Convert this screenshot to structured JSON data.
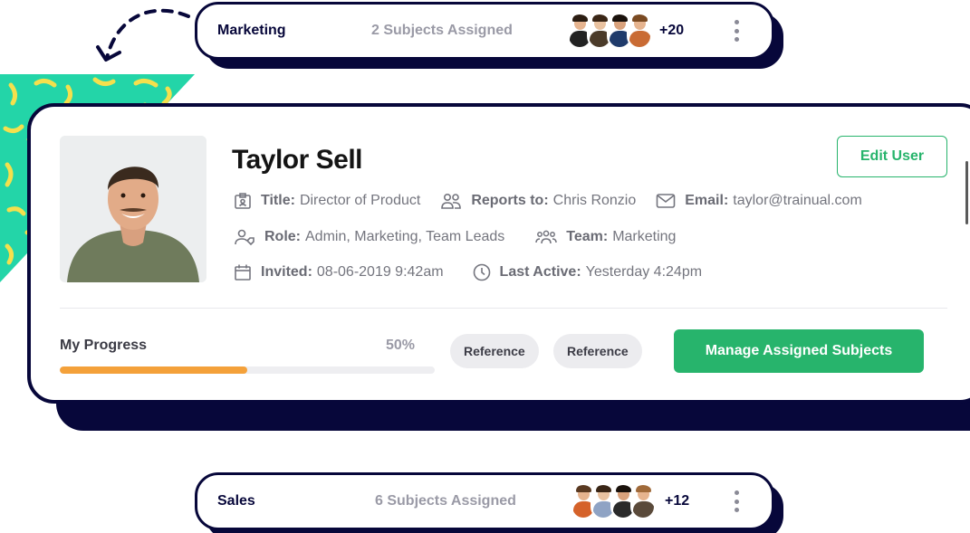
{
  "groups": {
    "top": {
      "name": "Marketing",
      "subjects": "2 Subjects Assigned",
      "more": "+20"
    },
    "bottom": {
      "name": "Sales",
      "subjects": "6 Subjects Assigned",
      "more": "+12"
    }
  },
  "user": {
    "name": "Taylor Sell",
    "edit_label": "Edit User",
    "title_key": "Title:",
    "title_value": "Director of Product",
    "reports_key": "Reports to:",
    "reports_value": "Chris Ronzio",
    "email_key": "Email:",
    "email_value": "taylor@trainual.com",
    "role_key": "Role:",
    "role_value": "Admin, Marketing, Team Leads",
    "team_key": "Team:",
    "team_value": "Marketing",
    "invited_key": "Invited:",
    "invited_value": "08-06-2019 9:42am",
    "active_key": "Last Active:",
    "active_value": "Yesterday 4:24pm"
  },
  "progress": {
    "label": "My Progress",
    "percent_text": "50%",
    "fraction": 0.5
  },
  "actions": {
    "reference_1": "Reference",
    "reference_2": "Reference",
    "manage_label": "Manage Assigned Subjects"
  },
  "colors": {
    "navy": "#07073a",
    "green": "#27b46c",
    "orange": "#f4a13a",
    "teal": "#23d5a8",
    "yellow": "#f4e04d"
  },
  "icons": [
    "title-badge-icon",
    "reports-users-icon",
    "email-icon",
    "role-user-tag-icon",
    "team-icon",
    "calendar-icon",
    "clock-icon",
    "kebab-menu-icon"
  ]
}
